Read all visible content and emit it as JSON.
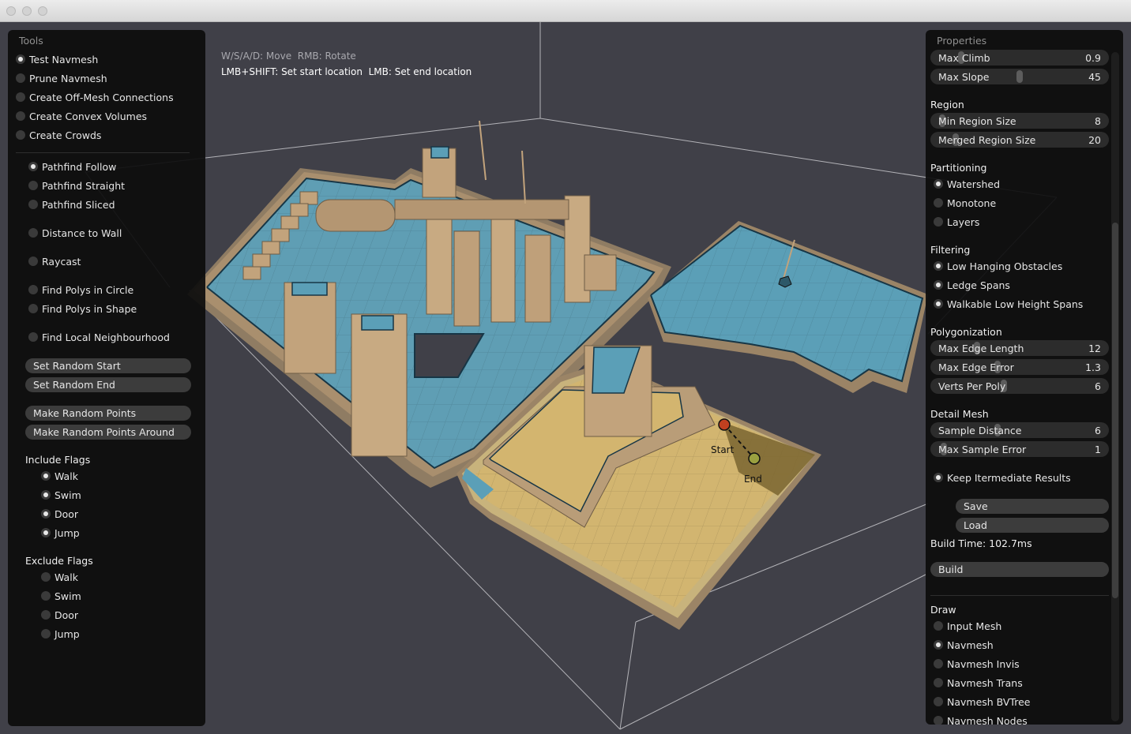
{
  "viewport": {
    "hint_line1": "W/S/A/D: Move  RMB: Rotate",
    "hint_line2": "LMB+SHIFT: Set start location  LMB: Set end location",
    "start_label": "Start",
    "end_label": "End"
  },
  "tools": {
    "title": "Tools",
    "modes": [
      {
        "label": "Test Navmesh",
        "checked": true
      },
      {
        "label": "Prune Navmesh",
        "checked": false
      },
      {
        "label": "Create Off-Mesh Connections",
        "checked": false
      },
      {
        "label": "Create Convex Volumes",
        "checked": false
      },
      {
        "label": "Create Crowds",
        "checked": false
      }
    ],
    "tests": [
      {
        "label": "Pathfind Follow",
        "checked": true
      },
      {
        "label": "Pathfind Straight",
        "checked": false
      },
      {
        "label": "Pathfind Sliced",
        "checked": false
      },
      {
        "label": "Distance to Wall",
        "checked": false
      },
      {
        "label": "Raycast",
        "checked": false
      },
      {
        "label": "Find Polys in Circle",
        "checked": false
      },
      {
        "label": "Find Polys in Shape",
        "checked": false
      },
      {
        "label": "Find Local Neighbourhood",
        "checked": false
      }
    ],
    "buttons": [
      "Set Random Start",
      "Set Random End",
      "Make Random Points",
      "Make Random Points Around"
    ],
    "include_title": "Include Flags",
    "include_flags": [
      {
        "label": "Walk",
        "checked": true
      },
      {
        "label": "Swim",
        "checked": true
      },
      {
        "label": "Door",
        "checked": true
      },
      {
        "label": "Jump",
        "checked": true
      }
    ],
    "exclude_title": "Exclude Flags",
    "exclude_flags": [
      {
        "label": "Walk",
        "checked": false
      },
      {
        "label": "Swim",
        "checked": false
      },
      {
        "label": "Door",
        "checked": false
      },
      {
        "label": "Jump",
        "checked": false
      }
    ]
  },
  "properties": {
    "title": "Properties",
    "sliders_top": [
      {
        "label": "Max Climb",
        "value": "0.9",
        "fraction": 0.16
      },
      {
        "label": "Max Slope",
        "value": "45",
        "fraction": 0.5
      }
    ],
    "region_title": "Region",
    "region_sliders": [
      {
        "label": "Min Region Size",
        "value": "8",
        "fraction": 0.05
      },
      {
        "label": "Merged Region Size",
        "value": "20",
        "fraction": 0.13
      }
    ],
    "partitioning_title": "Partitioning",
    "partitioning": [
      {
        "label": "Watershed",
        "checked": true
      },
      {
        "label": "Monotone",
        "checked": false
      },
      {
        "label": "Layers",
        "checked": false
      }
    ],
    "filtering_title": "Filtering",
    "filtering": [
      {
        "label": "Low Hanging Obstacles",
        "checked": true
      },
      {
        "label": "Ledge Spans",
        "checked": true
      },
      {
        "label": "Walkable Low Height Spans",
        "checked": true
      }
    ],
    "polygonization_title": "Polygonization",
    "polygonization_sliders": [
      {
        "label": "Max Edge Length",
        "value": "12",
        "fraction": 0.25
      },
      {
        "label": "Max Edge Error",
        "value": "1.3",
        "fraction": 0.37
      },
      {
        "label": "Verts Per Poly",
        "value": "6",
        "fraction": 0.41
      }
    ],
    "detail_title": "Detail Mesh",
    "detail_sliders": [
      {
        "label": "Sample Distance",
        "value": "6",
        "fraction": 0.37
      },
      {
        "label": "Max Sample Error",
        "value": "1",
        "fraction": 0.06
      }
    ],
    "keep_intermediate": {
      "label": "Keep Itermediate Results",
      "checked": true
    },
    "save_label": "Save",
    "load_label": "Load",
    "build_time": "Build Time: 102.7ms",
    "build_label": "Build",
    "draw_title": "Draw",
    "draw_items": [
      {
        "label": "Input Mesh",
        "checked": false
      },
      {
        "label": "Navmesh",
        "checked": true
      },
      {
        "label": "Navmesh Invis",
        "checked": false
      },
      {
        "label": "Navmesh Trans",
        "checked": false
      },
      {
        "label": "Navmesh BVTree",
        "checked": false
      },
      {
        "label": "Navmesh Nodes",
        "checked": false
      }
    ]
  }
}
